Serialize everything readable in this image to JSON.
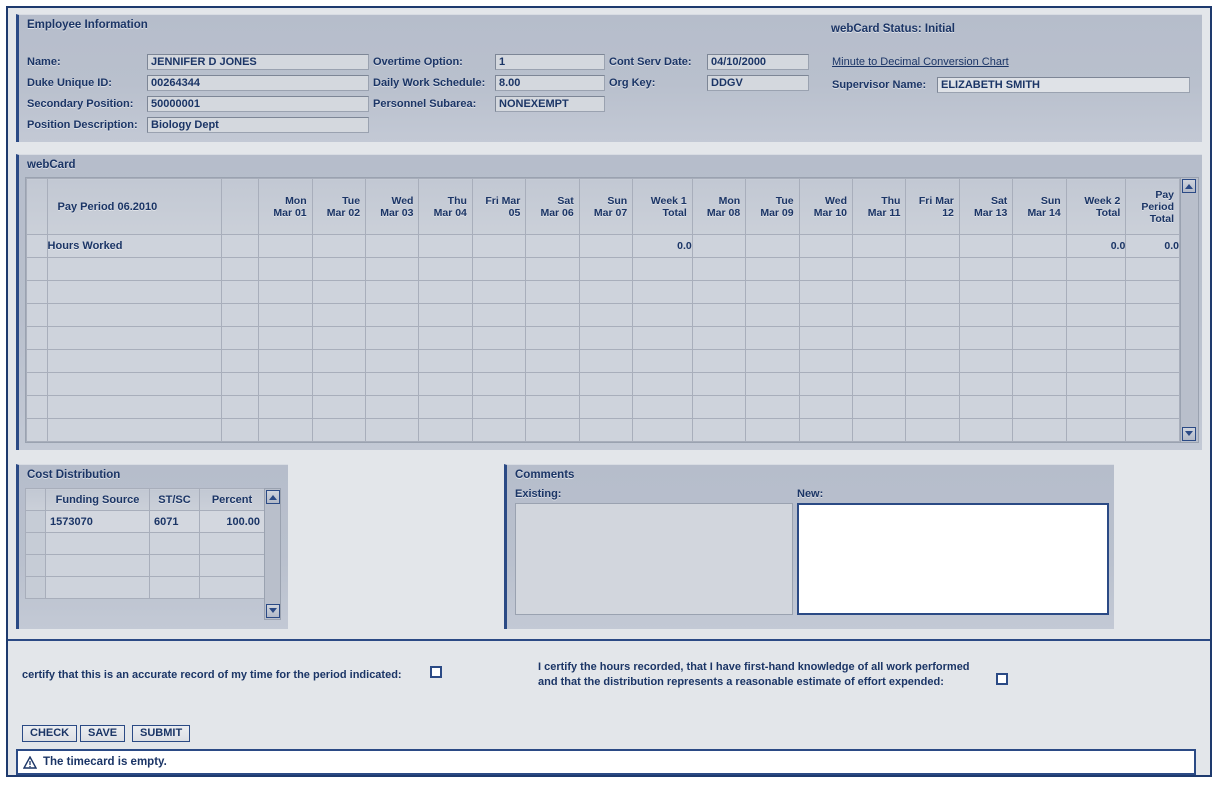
{
  "employee": {
    "section_title": "Employee Information",
    "fields": [
      {
        "label": "Name:",
        "value": "JENNIFER D JONES"
      },
      {
        "label": "Duke Unique ID:",
        "value": "00264344"
      },
      {
        "label": "Secondary Position:",
        "value": "50000001"
      },
      {
        "label": "Position Description:",
        "value": "Biology Dept"
      },
      {
        "label": "Overtime Option:",
        "value": "1"
      },
      {
        "label": "Daily Work Schedule:",
        "value": "8.00"
      },
      {
        "label": "Personnel Subarea:",
        "value": "NONEXEMPT"
      },
      {
        "label": "Cont Serv Date:",
        "value": "04/10/2000"
      },
      {
        "label": "Org Key:",
        "value": "DDGV"
      }
    ],
    "status_title": "webCard Status: Initial",
    "conversion_link": "Minute to Decimal Conversion Chart",
    "supervisor_label": "Supervisor Name:",
    "supervisor_value": "ELIZABETH SMITH"
  },
  "webcard": {
    "section_title": "webCard",
    "pay_period_label": "Pay Period 06.2010",
    "columns": [
      "Mon Mar 01",
      "Tue Mar 02",
      "Wed Mar 03",
      "Thu Mar 04",
      "Fri Mar 05",
      "Sat Mar 06",
      "Sun Mar 07",
      "Week 1 Total",
      "Mon Mar 08",
      "Tue Mar 09",
      "Wed Mar 10",
      "Thu Mar 11",
      "Fri Mar 12",
      "Sat Mar 13",
      "Sun Mar 14",
      "Week 2 Total",
      "Pay Period Total"
    ],
    "column_lines": [
      [
        "Mon",
        "Mar 01"
      ],
      [
        "Tue",
        "Mar 02"
      ],
      [
        "Wed",
        "Mar 03"
      ],
      [
        "Thu",
        "Mar 04"
      ],
      [
        "Fri Mar",
        "05"
      ],
      [
        "Sat",
        "Mar 06"
      ],
      [
        "Sun",
        "Mar 07"
      ],
      [
        "Week 1",
        "Total"
      ],
      [
        "Mon",
        "Mar 08"
      ],
      [
        "Tue",
        "Mar 09"
      ],
      [
        "Wed",
        "Mar 10"
      ],
      [
        "Thu",
        "Mar 11"
      ],
      [
        "Fri Mar",
        "12"
      ],
      [
        "Sat",
        "Mar 13"
      ],
      [
        "Sun",
        "Mar 14"
      ],
      [
        "Week 2",
        "Total"
      ],
      [
        "Pay",
        "Period",
        "Total"
      ]
    ],
    "rows": [
      {
        "label": "Hours Worked",
        "days1": [
          "",
          "",
          "",
          "",
          "",
          "",
          ""
        ],
        "week1_total": "0.0",
        "days2": [
          "",
          "",
          "",
          "",
          "",
          "",
          ""
        ],
        "week2_total": "0.0",
        "period_total": "0.0"
      }
    ],
    "empty_row_count": 8
  },
  "cost_distribution": {
    "section_title": "Cost Distribution",
    "headers": [
      "Funding Source",
      "ST/SC",
      "Percent"
    ],
    "rows": [
      {
        "funding_source": "1573070",
        "st_sc": "6071",
        "percent": "100.00"
      }
    ],
    "empty_row_count": 3
  },
  "comments": {
    "section_title": "Comments",
    "existing_label": "Existing:",
    "existing_value": "",
    "new_label": "New:",
    "new_value": ""
  },
  "certification": {
    "left_text": "certify that this is an accurate record of my time for the period indicated:",
    "left_checked": false,
    "right_line1": "I certify the hours recorded, that I have first-hand knowledge of all work performed",
    "right_line2": "and that the distribution represents a reasonable estimate of effort expended:",
    "right_checked": false
  },
  "buttons": [
    {
      "label": "CHECK"
    },
    {
      "label": "SAVE"
    },
    {
      "label": "SUBMIT"
    }
  ],
  "status": {
    "icon": "warning-triangle-icon",
    "message": "The timecard is empty."
  },
  "colors": {
    "border_blue": "#2b4a85",
    "text_blue": "#1b3566",
    "panel_bg": "#b9c0cd",
    "page_bg": "#e3e6ea",
    "grid_cell": "#ced3dc",
    "entry_cell": "#ffffff"
  }
}
